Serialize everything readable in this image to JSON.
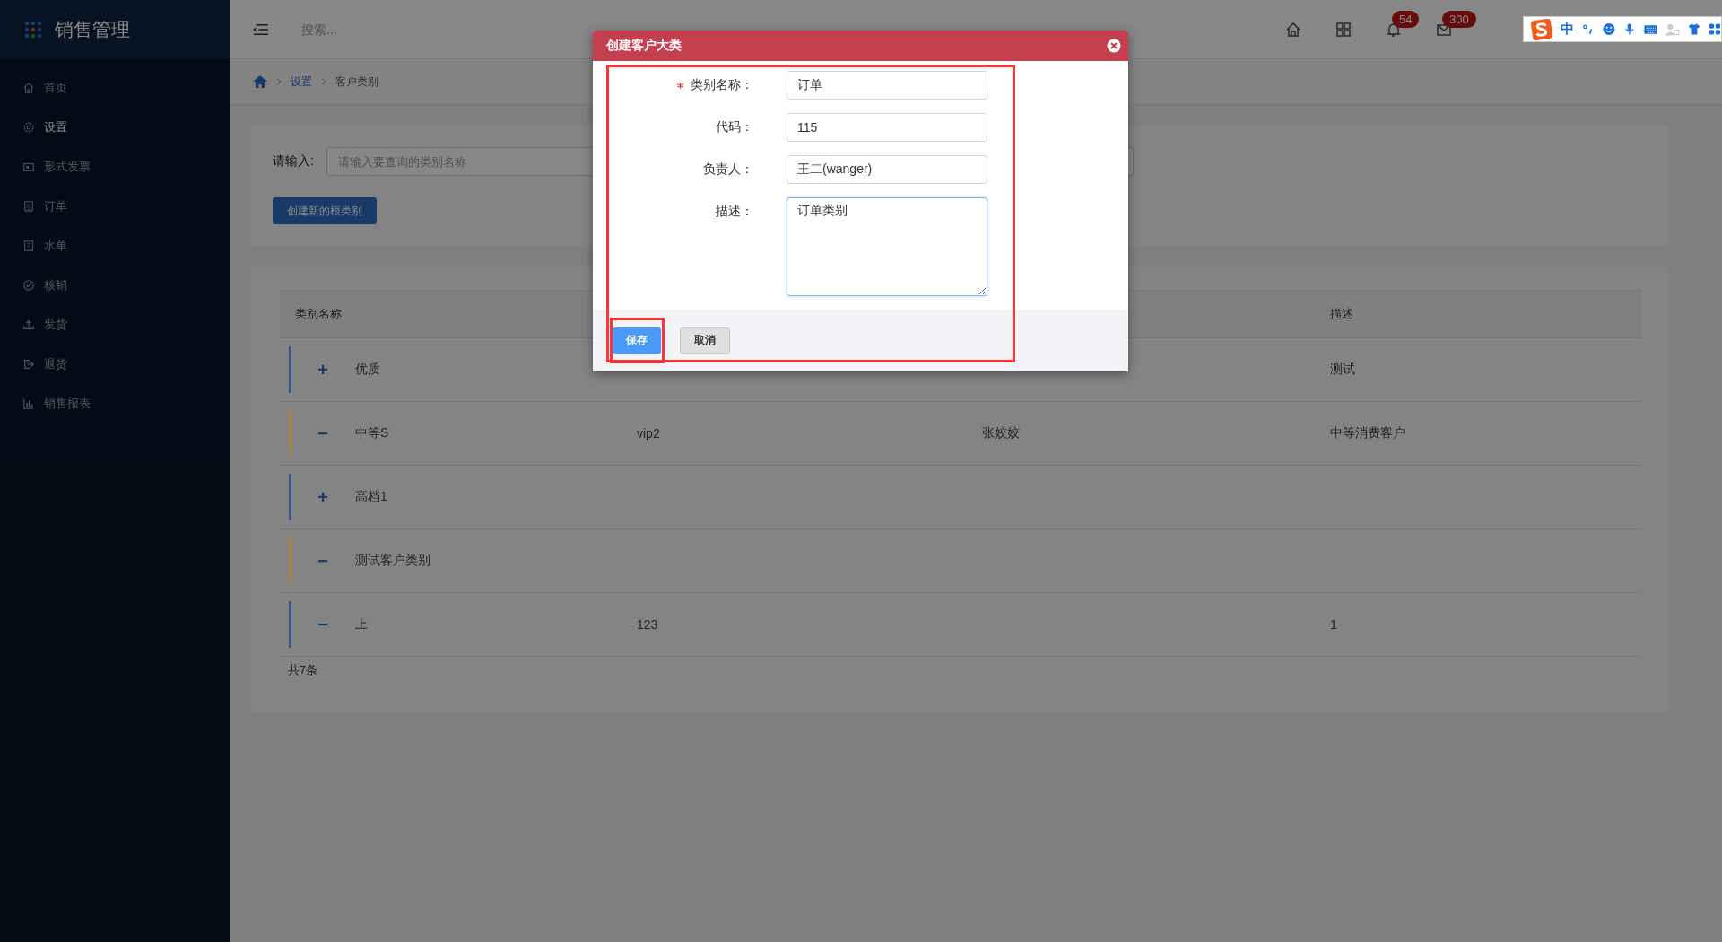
{
  "sidebar": {
    "title": "销售管理",
    "items": [
      {
        "label": "首页",
        "kind": "home",
        "selected": false
      },
      {
        "label": "设置",
        "kind": "gear",
        "selected": true
      },
      {
        "label": "形式发票",
        "kind": "invoice",
        "selected": false
      },
      {
        "label": "订单",
        "kind": "clipboard",
        "selected": false
      },
      {
        "label": "水单",
        "kind": "receipt",
        "selected": false
      },
      {
        "label": "核销",
        "kind": "check",
        "selected": false
      },
      {
        "label": "发货",
        "kind": "upload",
        "selected": false
      },
      {
        "label": "退货",
        "kind": "exit",
        "selected": false
      },
      {
        "label": "销售报表",
        "kind": "chart",
        "selected": false
      }
    ]
  },
  "topbar": {
    "search": {
      "placeholder": "搜索..."
    },
    "icons": [
      {
        "kind": "home"
      },
      {
        "kind": "grid"
      },
      {
        "kind": "bell",
        "badge": "54"
      },
      {
        "kind": "mail",
        "badge": "300"
      }
    ]
  },
  "breadcrumb": [
    {
      "label": "设置",
      "link": true
    },
    {
      "label": "客户类别",
      "link": false
    }
  ],
  "filter": {
    "label": "请输入:",
    "placeholder": "请输入要查询的类别名称",
    "button": "创建新的根类别"
  },
  "table": {
    "columns": {
      "column_1": "类别名称",
      "column_4": "描述"
    },
    "rows": [
      {
        "toggle": "+",
        "name": "优质",
        "column_4": "测试",
        "color": "#34558f"
      },
      {
        "toggle": "−",
        "name": "中等S",
        "column_2": "vip2",
        "column_3": "张姣姣",
        "column_4": "中等消费客户",
        "color": "#a8843c"
      },
      {
        "toggle": "+",
        "name": "高档1",
        "color": "#34558f"
      },
      {
        "toggle": "−",
        "name": "测试客户类别",
        "color": "#a8843c"
      },
      {
        "toggle": "−",
        "name": "上",
        "column_2": "123",
        "column_4": "1",
        "color": "#34558f"
      }
    ],
    "footer": "共7条"
  },
  "dialog": {
    "title": "创建客户大类",
    "fields": [
      {
        "kind": "input",
        "label": "类别名称：",
        "required": true,
        "value": "订单",
        "focused": false
      },
      {
        "kind": "input",
        "label": "代码：",
        "required": false,
        "value": "115",
        "focused": false
      },
      {
        "kind": "input",
        "label": "负责人：",
        "required": false,
        "value": "王二(wanger)",
        "focused": false
      },
      {
        "kind": "textarea",
        "label": "描述：",
        "required": false,
        "value": "订单类别",
        "focused": true
      }
    ],
    "buttons": [
      {
        "kind": "primary",
        "label": "保存"
      },
      {
        "kind": "default",
        "label": "取消"
      }
    ]
  },
  "ime": {
    "mode": "中"
  }
}
